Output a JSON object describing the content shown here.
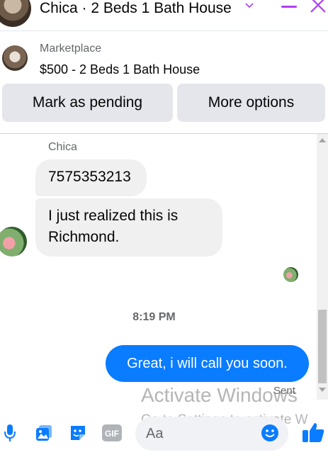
{
  "header": {
    "title": "Chica · 2 Beds 1 Bath House",
    "chevron_icon": "chevron-down-icon",
    "minimize_icon": "minimize-icon",
    "close_icon": "close-icon",
    "accent_color": "#b13ef0"
  },
  "marketplace": {
    "label": "Marketplace",
    "listing": "$500 - 2 Beds 1 Bath House"
  },
  "actions": {
    "pending_label": "Mark as pending",
    "more_label": "More options"
  },
  "conversation": {
    "sender": "Chica",
    "incoming": [
      {
        "text": "7575353213"
      },
      {
        "text": "I just realized this is Richmond."
      }
    ],
    "timestamp": "8:19 PM",
    "outgoing": [
      {
        "text": "Great, i will call you soon."
      }
    ],
    "status": "Sent",
    "outgoing_color": "#0a7cff"
  },
  "watermark": {
    "line1": "Activate Windows",
    "line2": "Go to Settings to activate W"
  },
  "composer": {
    "placeholder": "Aa",
    "icons": [
      "microphone-icon",
      "photo-icon",
      "sticker-icon",
      "gif-icon",
      "emoji-icon",
      "thumbs-up-icon"
    ],
    "gif_label": "GIF",
    "icon_color": "#0a7cff"
  }
}
